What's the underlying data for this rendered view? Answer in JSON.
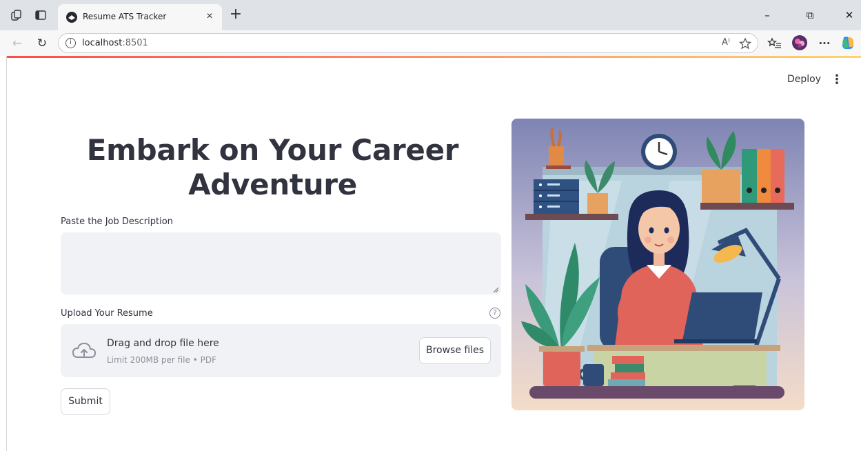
{
  "browser": {
    "tab_title": "Resume ATS Tracker",
    "tab_close": "×",
    "new_tab": "+",
    "url_host": "localhost",
    "url_port": ":8501",
    "window_minimize": "–",
    "window_restore": "⧉",
    "window_close": "✕",
    "read_aloud": "A⁾",
    "more": "···"
  },
  "app": {
    "deploy_label": "Deploy",
    "menu_glyph": "⋮",
    "hero_title": "Embark on Your Career Adventure",
    "jd_label": "Paste the Job Description",
    "jd_value": "",
    "upload_label": "Upload Your Resume",
    "help_glyph": "?",
    "dropzone_title": "Drag and drop file here",
    "dropzone_subtitle": "Limit 200MB per file • PDF",
    "browse_label": "Browse files",
    "submit_label": "Submit"
  },
  "colors": {
    "accent_red": "#ff4b4b",
    "text": "#31333f",
    "input_bg": "#f0f2f6"
  }
}
